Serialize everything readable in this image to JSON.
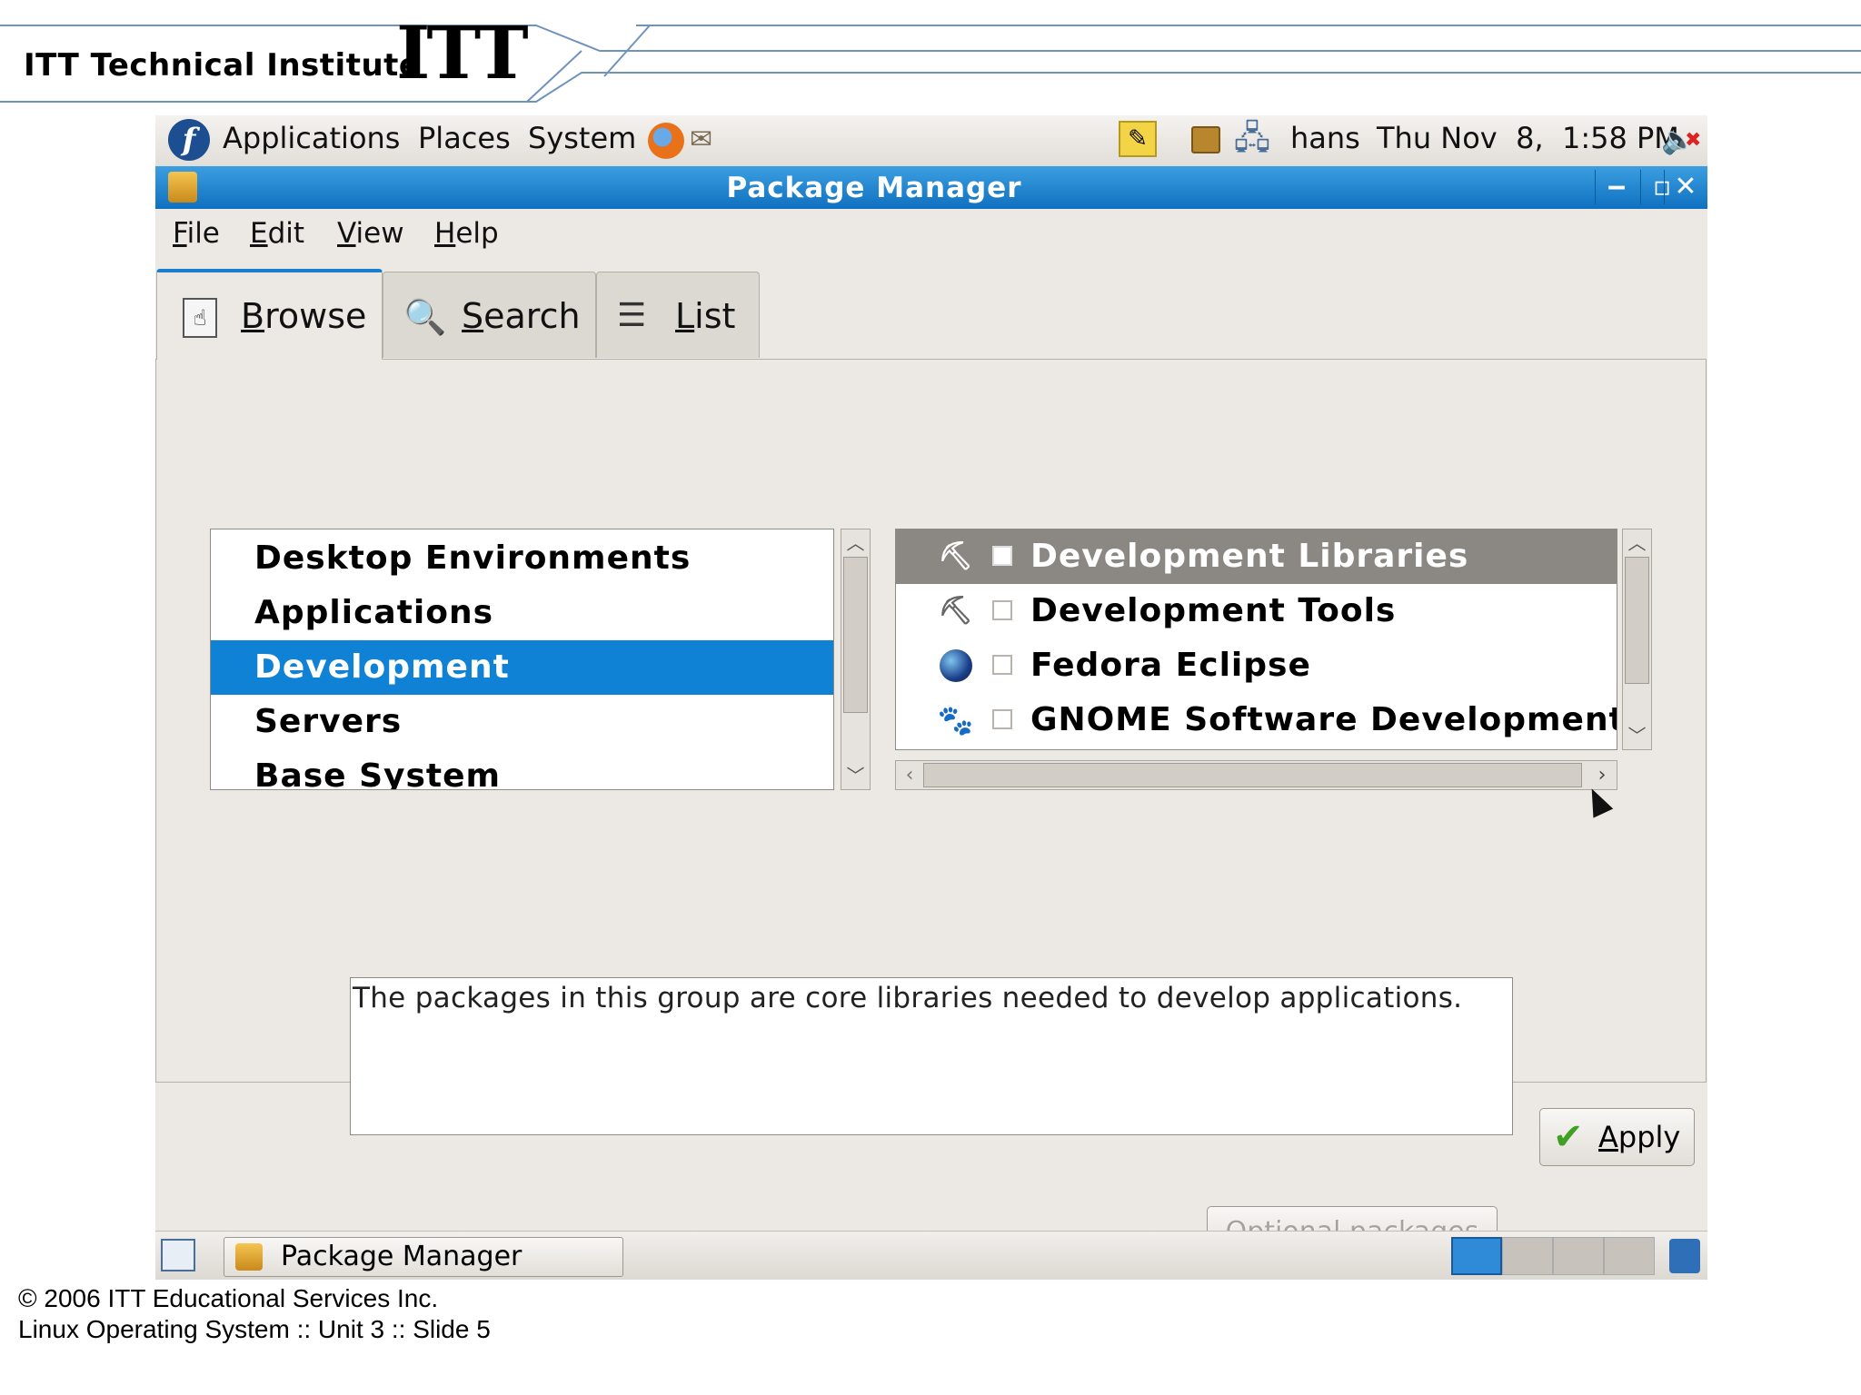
{
  "slide": {
    "brand_text": "ITT Technical Institute",
    "brand_logo": "ITT",
    "copyright": "© 2006 ITT Educational Services Inc.",
    "footer": "Linux Operating System :: Unit 3 :: Slide 5"
  },
  "top_panel": {
    "menus": [
      "Applications",
      "Places",
      "System"
    ],
    "user": "hans",
    "clock": "Thu Nov  8,  1:58 PM",
    "icons": [
      "fedora-logo-icon",
      "firefox-icon",
      "mail-icon",
      "notes-icon",
      "package-icon",
      "network-icon",
      "volume-muted-icon"
    ]
  },
  "window": {
    "title": "Package Manager",
    "controls": [
      "minimize",
      "maximize",
      "close"
    ]
  },
  "menubar": {
    "items": [
      {
        "mnemonic": "F",
        "rest": "ile"
      },
      {
        "mnemonic": "E",
        "rest": "dit"
      },
      {
        "mnemonic": "V",
        "rest": "iew"
      },
      {
        "mnemonic": "H",
        "rest": "elp"
      }
    ]
  },
  "tabs": [
    {
      "mnemonic": "B",
      "rest": "rowse",
      "icon": "browse-icon",
      "active": true
    },
    {
      "mnemonic": "S",
      "rest": "earch",
      "icon": "magnifier-icon",
      "active": false
    },
    {
      "mnemonic": "L",
      "rest": "ist",
      "icon": "list-icon",
      "active": false
    }
  ],
  "groups": {
    "items": [
      "Desktop Environments",
      "Applications",
      "Development",
      "Servers",
      "Base System"
    ],
    "selected_index": 2
  },
  "packages": {
    "items": [
      {
        "label": "Development Libraries",
        "icon": "dev-libraries-icon",
        "checked": false,
        "selected": true
      },
      {
        "label": "Development Tools",
        "icon": "dev-tools-icon",
        "checked": false,
        "selected": false
      },
      {
        "label": "Fedora Eclipse",
        "icon": "eclipse-icon",
        "checked": false,
        "selected": false
      },
      {
        "label": "GNOME Software Development",
        "icon": "gnome-foot-icon",
        "checked": false,
        "selected": false
      }
    ]
  },
  "description": "The packages in this group are core libraries needed to develop applications.",
  "buttons": {
    "optional": {
      "mnemonic": "O",
      "rest": "ptional packages",
      "enabled": false
    },
    "apply": {
      "mnemonic": "A",
      "rest": "pply"
    }
  },
  "taskbar": {
    "task": "Package Manager"
  },
  "colors": {
    "titlebar": "#1b7fd0",
    "selection": "#0f82d6",
    "selected_package_row": "#8b8883"
  }
}
